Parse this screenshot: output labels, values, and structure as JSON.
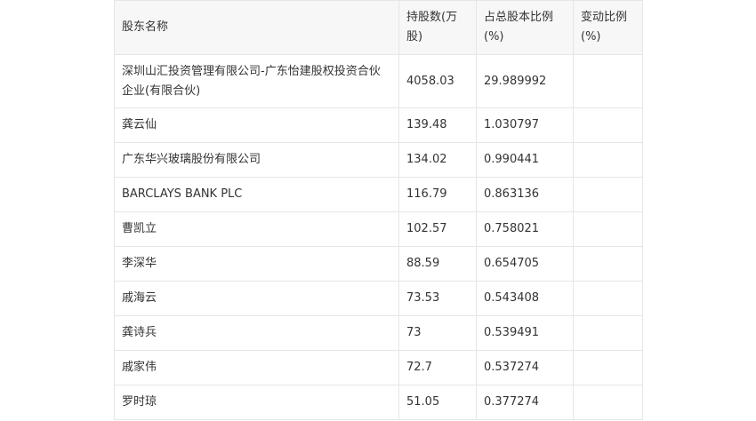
{
  "table": {
    "headers": [
      "股东名称",
      "持股数(万股)",
      "占总股本比例(%)",
      "变动比例(%)"
    ],
    "rows": [
      [
        "深圳山汇投资管理有限公司-广东怡建股权投资合伙企业(有限合伙)",
        "4058.03",
        "29.989992",
        ""
      ],
      [
        "龚云仙",
        "139.48",
        "1.030797",
        ""
      ],
      [
        "广东华兴玻璃股份有限公司",
        "134.02",
        "0.990441",
        ""
      ],
      [
        "BARCLAYS BANK PLC",
        "116.79",
        "0.863136",
        ""
      ],
      [
        "曹凯立",
        "102.57",
        "0.758021",
        ""
      ],
      [
        "李深华",
        "88.59",
        "0.654705",
        ""
      ],
      [
        "戚海云",
        "73.53",
        "0.543408",
        ""
      ],
      [
        "龚诗兵",
        "73",
        "0.539491",
        ""
      ],
      [
        "戚家伟",
        "72.7",
        "0.537274",
        ""
      ],
      [
        "罗时琼",
        "51.05",
        "0.377274",
        ""
      ]
    ]
  }
}
